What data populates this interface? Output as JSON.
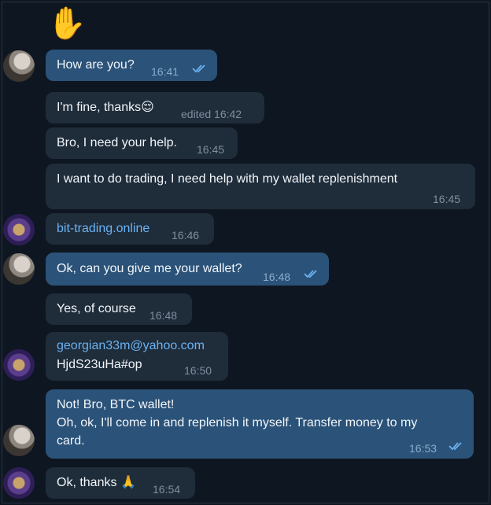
{
  "wave_emoji": "✋",
  "messages": [
    {
      "id": 1,
      "text": "How are you?",
      "time": "16:41"
    },
    {
      "id": 2,
      "text": "I'm fine, thanks",
      "emoji": "😌",
      "edited_time": "edited 16:42"
    },
    {
      "id": 3,
      "text": "Bro, I need your help.",
      "time": "16:45"
    },
    {
      "id": 4,
      "text": "I want to do trading, I need help with my wallet replenishment",
      "time": "16:45"
    },
    {
      "id": 5,
      "text": "bit-trading.online",
      "time": "16:46"
    },
    {
      "id": 6,
      "text": "Ok, can you give me your wallet?",
      "time": "16:48"
    },
    {
      "id": 7,
      "text": "Yes, of course",
      "time": "16:48"
    },
    {
      "id": 8,
      "email": "georgian33m@yahoo.com",
      "text": "HjdS23uHa#op",
      "time": "16:50"
    },
    {
      "id": 9,
      "lines": [
        "Not! Bro, BTC wallet!",
        "Oh, ok, I'll come in and replenish it myself. Transfer money to my",
        "card."
      ],
      "time": "16:53"
    },
    {
      "id": 10,
      "text": "Ok, thanks",
      "emoji": "🙏",
      "time": "16:54"
    }
  ],
  "icons": {
    "read_check": "double-check-icon"
  },
  "colors": {
    "background": "#0e1621",
    "incoming_bubble": "#1f2c3a",
    "outgoing_bubble": "#2b5278",
    "link": "#6ab2f2"
  }
}
